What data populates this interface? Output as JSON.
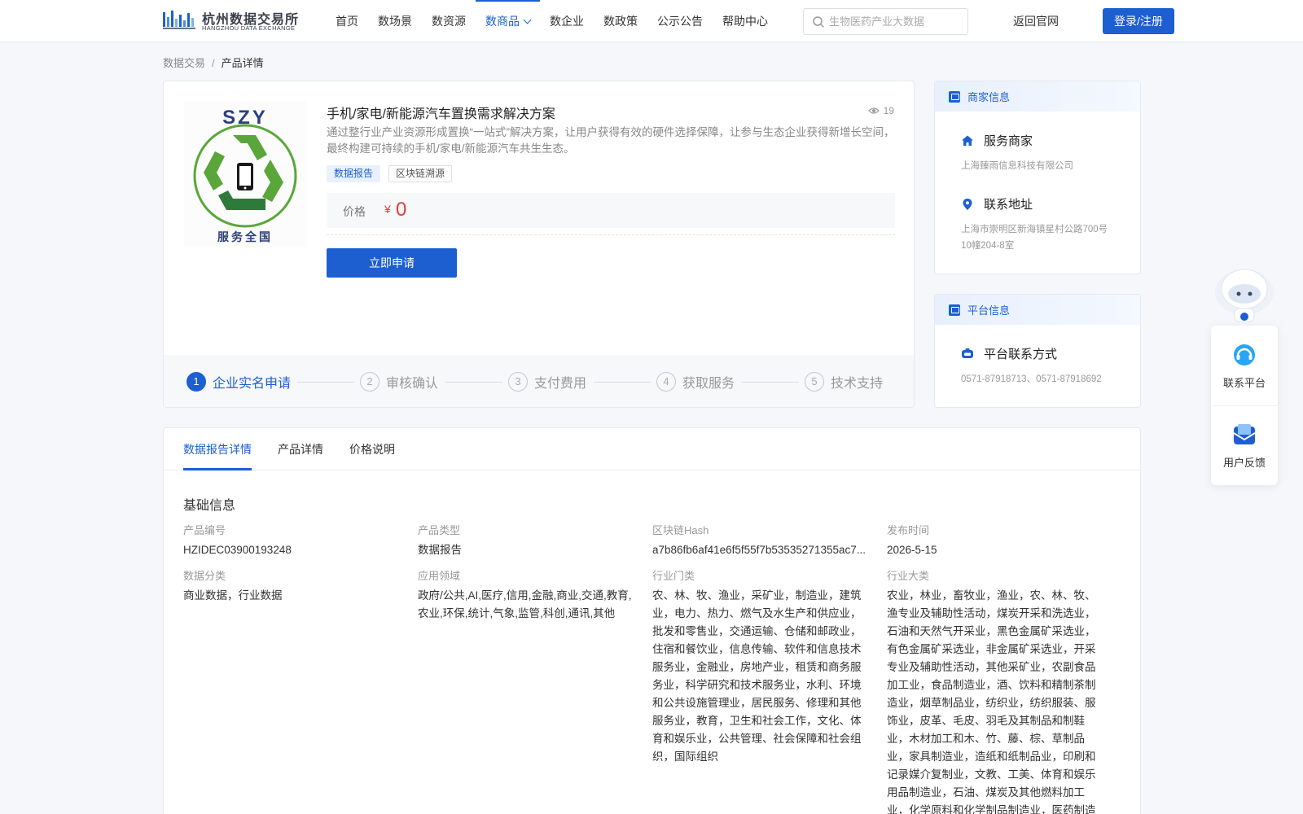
{
  "header": {
    "logo_cn": "杭州数据交易所",
    "logo_en": "HANGZHOU DATA EXCHANGE",
    "nav": [
      {
        "label": "首页"
      },
      {
        "label": "数场景"
      },
      {
        "label": "数资源"
      },
      {
        "label": "数商品"
      },
      {
        "label": "数企业"
      },
      {
        "label": "数政策"
      },
      {
        "label": "公示公告"
      },
      {
        "label": "帮助中心"
      }
    ],
    "active_nav": "数商品",
    "search_placeholder": "生物医药产业大数据",
    "back_link": "返回官网",
    "login_label": "登录/注册"
  },
  "breadcrumb": {
    "root": "数据交易",
    "sep": "/",
    "current": "产品详情"
  },
  "product": {
    "title": "手机/家电/新能源汽车置换需求解决方案",
    "views": "19",
    "description": "通过整行业产业资源形成置换“一站式”解决方案，让用户获得有效的硬件选择保障，让参与生态企业获得新增长空间，最终构建可持续的手机/家电/新能源汽车共生生态。",
    "tags": [
      "数据报告",
      "区块链溯源"
    ],
    "price_label": "价格",
    "currency": "¥",
    "price": "0",
    "apply_label": "立即申请",
    "image_text_top": "SZY",
    "image_text_bottom": "服务全国"
  },
  "steps": [
    {
      "num": "1",
      "label": "企业实名申请"
    },
    {
      "num": "2",
      "label": "审核确认"
    },
    {
      "num": "3",
      "label": "支付费用"
    },
    {
      "num": "4",
      "label": "获取服务"
    },
    {
      "num": "5",
      "label": "技术支持"
    }
  ],
  "merchant": {
    "head": "商家信息",
    "service_title": "服务商家",
    "service_value": "上海臻雨信息科技有限公司",
    "address_title": "联系地址",
    "address_value": "上海市崇明区新海镇星村公路700号10幢204-8室"
  },
  "platform": {
    "head": "平台信息",
    "contact_title": "平台联系方式",
    "contact_value": "0571-87918713、0571-87918692"
  },
  "floating": {
    "contact_label": "联系平台",
    "feedback_label": "用户反馈"
  },
  "tabs": [
    {
      "label": "数据报告详情"
    },
    {
      "label": "产品详情"
    },
    {
      "label": "价格说明"
    }
  ],
  "details": {
    "section_title": "基础信息",
    "product_no_label": "产品编号",
    "product_no": "HZIDEC03900193248",
    "product_type_label": "产品类型",
    "product_type": "数据报告",
    "hash_label": "区块链Hash",
    "hash": "a7b86fb6af41e6f5f55f7b53535271355ac7...",
    "publish_label": "发布时间",
    "publish_time": "2026-5-15",
    "category_label": "数据分类",
    "category": "商业数据，行业数据",
    "application_label": "应用领域",
    "application": "政府/公共,AI,医疗,信用,金融,商业,交通,教育,农业,环保,统计,气象,监管,科创,通讯,其他",
    "industry_door_label": "行业门类",
    "industry_door": "农、林、牧、渔业，采矿业，制造业，建筑业，电力、热力、燃气及水生产和供应业，批发和零售业，交通运输、仓储和邮政业，住宿和餐饮业，信息传输、软件和信息技术服务业，金融业，房地产业，租赁和商务服务业，科学研究和技术服务业，水利、环境和公共设施管理业，居民服务、修理和其他服务业，教育，卫生和社会工作，文化、体育和娱乐业，公共管理、社会保障和社会组织，国际组织",
    "industry_major_label": "行业大类",
    "industry_major": "农业，林业，畜牧业，渔业，农、林、牧、渔专业及辅助性活动，煤炭开采和洗选业，石油和天然气开采业，黑色金属矿采选业，有色金属矿采选业，非金属矿采选业，开采专业及辅助性活动，其他采矿业，农副食品加工业，食品制造业，酒、饮料和精制茶制造业，烟草制品业，纺织业，纺织服装、服饰业，皮革、毛皮、羽毛及其制品和制鞋业，木材加工和木、竹、藤、棕、草制品业，家具制造业，造纸和纸制品业，印刷和记录媒介复制业，文教、工美、体育和娱乐用品制造业，石油、煤炭及其他燃料加工业，化学原料和化学制品制造业，医药制造业"
  },
  "colors": {
    "brand": "#1d5fd1",
    "price": "#e53935",
    "recycle_green": "#5aa63a"
  }
}
